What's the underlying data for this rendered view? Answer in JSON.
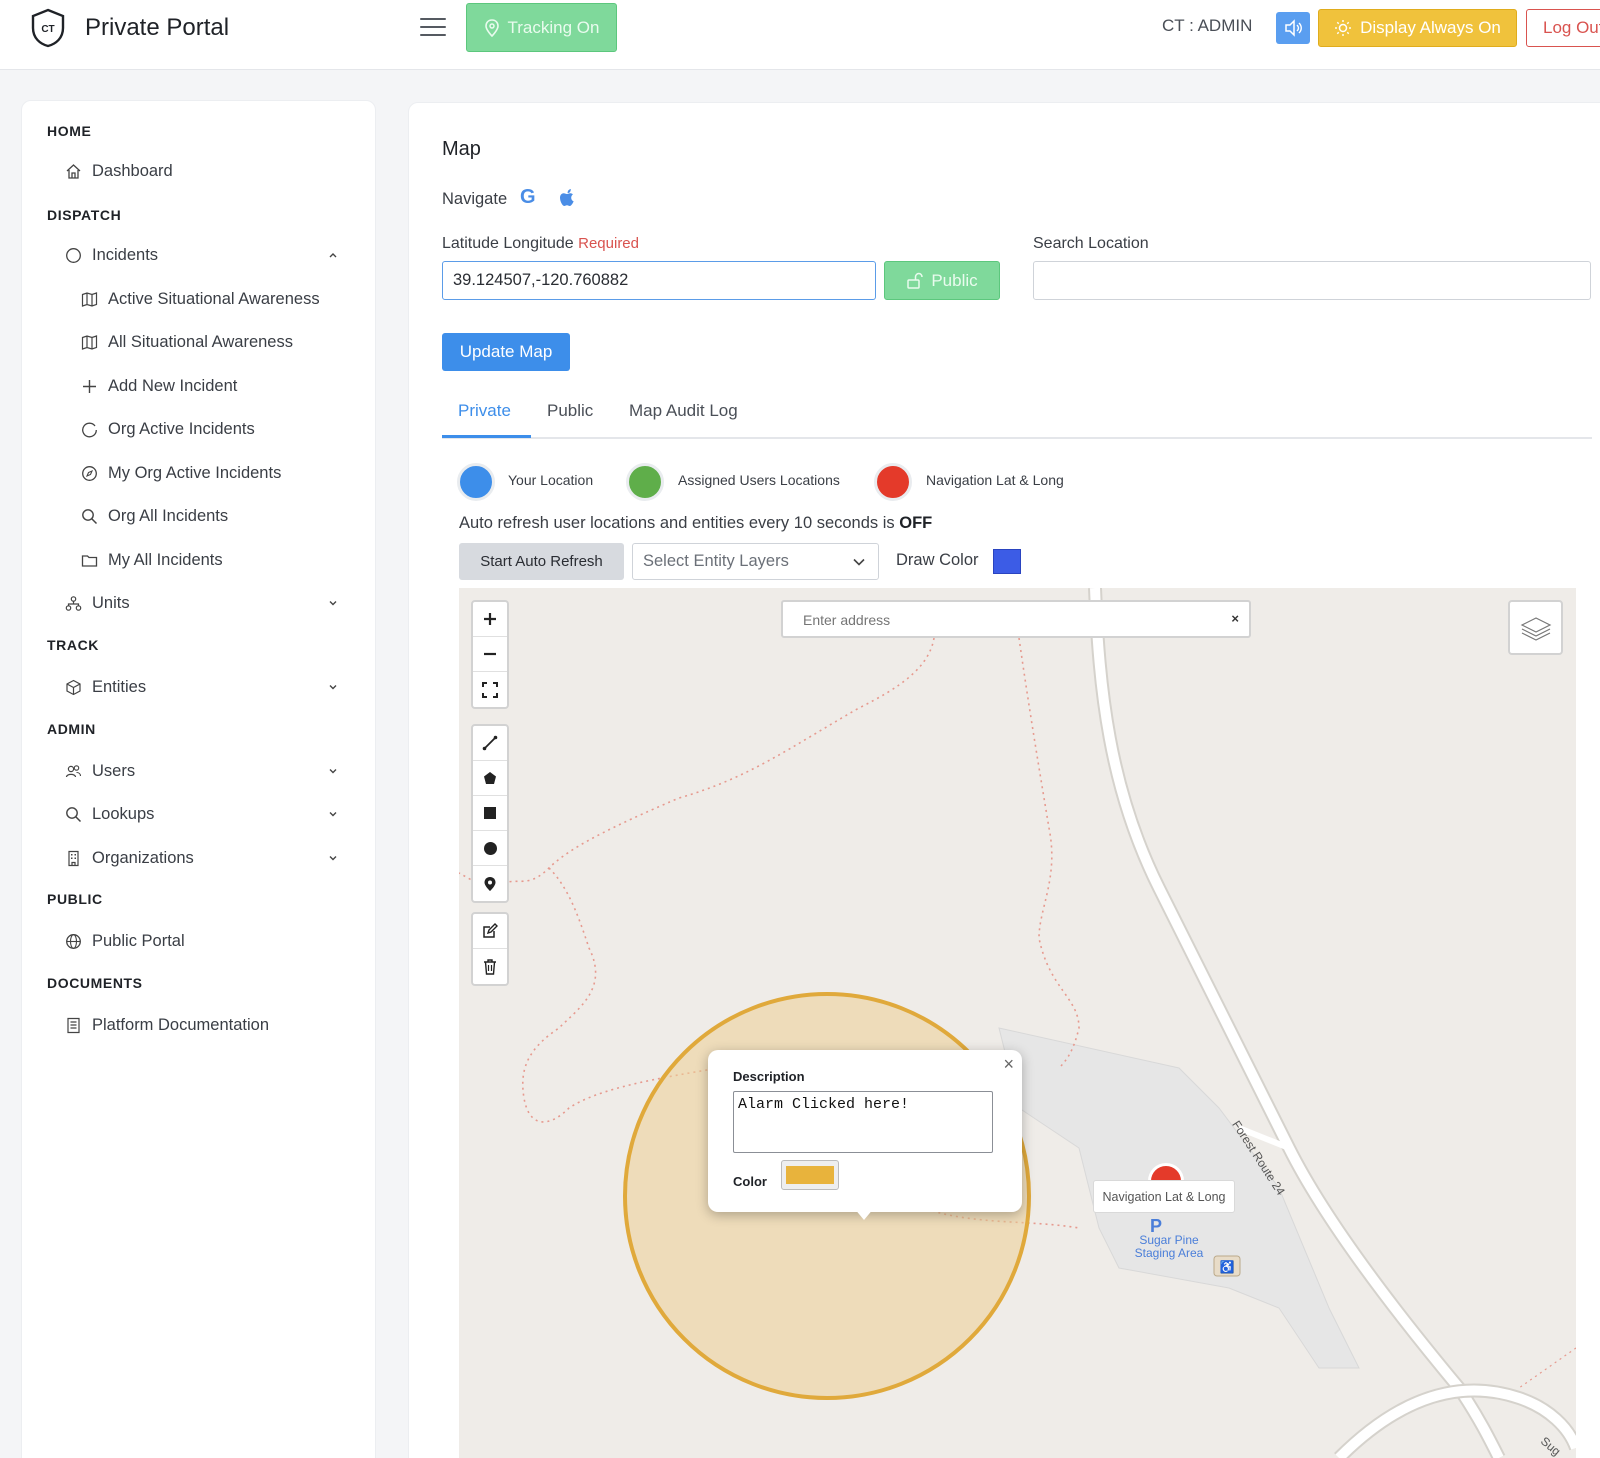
{
  "header": {
    "logo_text": "CT",
    "brand": "Private Portal",
    "tracking_label": "Tracking On",
    "user_label": "CT : ADMIN",
    "display_label": "Display Always On",
    "logout_label": "Log Out",
    "colors": {
      "tracking": "#7fd99b",
      "display": "#f0c23c",
      "logout": "#d9534f",
      "speaker": "#5a9ef0"
    }
  },
  "sidebar": {
    "sections": {
      "home": "HOME",
      "dispatch": "DISPATCH",
      "track": "TRACK",
      "admin": "ADMIN",
      "public": "PUBLIC",
      "documents": "DOCUMENTS"
    },
    "items": {
      "dashboard": "Dashboard",
      "incidents": "Incidents",
      "active_sa": "Active Situational Awareness",
      "all_sa": "All Situational Awareness",
      "add_incident": "Add New Incident",
      "org_active": "Org Active Incidents",
      "my_org_active": "My Org Active Incidents",
      "org_all": "Org All Incidents",
      "my_all": "My All Incidents",
      "units": "Units",
      "entities": "Entities",
      "users": "Users",
      "lookups": "Lookups",
      "organizations": "Organizations",
      "public_portal": "Public Portal",
      "platform_docs": "Platform Documentation"
    }
  },
  "main": {
    "title": "Map",
    "navigate_label": "Navigate",
    "navigate_google": "G",
    "latlong_label": "Latitude Longitude",
    "required_label": "Required",
    "latlong_value": "39.124507,-120.760882",
    "public_button": "Public",
    "search_location_label": "Search Location",
    "search_location_value": "",
    "update_button": "Update Map",
    "tabs": [
      "Private",
      "Public",
      "Map Audit Log"
    ],
    "active_tab": "Private",
    "legend": [
      {
        "label": "Your Location",
        "color": "#3d8eea"
      },
      {
        "label": "Assigned Users Locations",
        "color": "#5fae4a"
      },
      {
        "label": "Navigation Lat & Long",
        "color": "#e43a2a"
      }
    ],
    "refresh_text": "Auto refresh user locations and entities every 10 seconds is",
    "refresh_state": "OFF",
    "start_refresh_button": "Start Auto Refresh",
    "entity_layers_placeholder": "Select Entity Layers",
    "draw_color_label": "Draw Color",
    "draw_color": "#3c5ce6"
  },
  "map": {
    "address_placeholder": "Enter address",
    "address_clear": "×",
    "popup": {
      "description_label": "Description",
      "description_value": "Alarm Clicked here!",
      "color_label": "Color",
      "color": "#e8b33c",
      "close": "×"
    },
    "marker_tooltip": "Navigation Lat & Long",
    "poi_symbol": "P",
    "poi_label": "Sugar Pine Staging Area",
    "road_label": "Forest Route 24",
    "road_label_2": "Sug"
  }
}
